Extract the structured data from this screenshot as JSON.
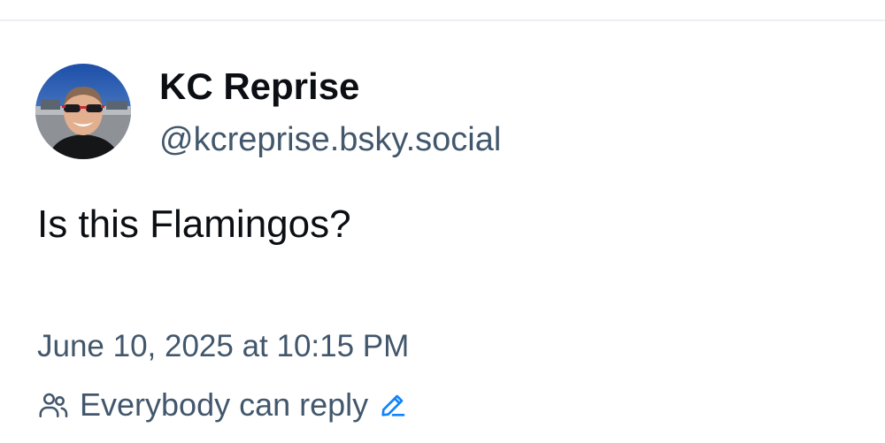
{
  "post": {
    "author": {
      "display_name": "KC Reprise",
      "handle": "@kcreprise.bsky.social",
      "avatar": "profile-photo"
    },
    "text": "Is this Flamingos?",
    "timestamp": "June 10, 2025 at 10:15 PM",
    "reply_setting": {
      "icon": "people-icon",
      "label": "Everybody can reply",
      "edit_icon": "pencil-icon"
    }
  },
  "colors": {
    "primary_text": "#0b0f14",
    "secondary_text": "#42576c",
    "accent": "#1083fe",
    "divider": "#eceff3"
  }
}
